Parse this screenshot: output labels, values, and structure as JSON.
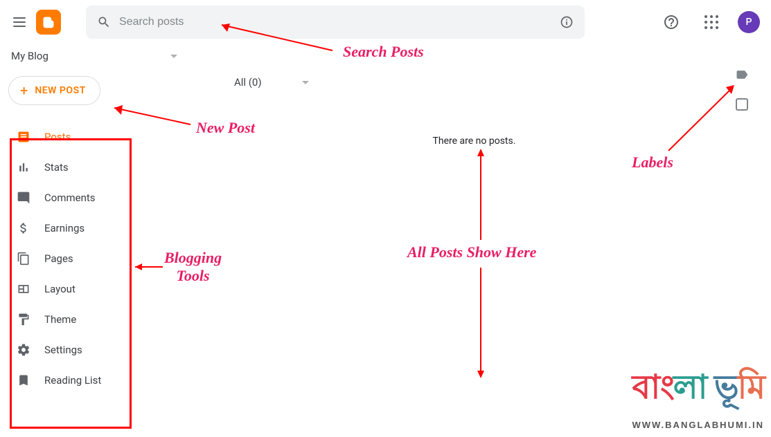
{
  "header": {
    "search_placeholder": "Search posts",
    "avatar_letter": "P"
  },
  "blog": {
    "name": "My Blog"
  },
  "sidebar": {
    "new_post_label": "NEW POST",
    "items": [
      {
        "label": "Posts"
      },
      {
        "label": "Stats"
      },
      {
        "label": "Comments"
      },
      {
        "label": "Earnings"
      },
      {
        "label": "Pages"
      },
      {
        "label": "Layout"
      },
      {
        "label": "Theme"
      },
      {
        "label": "Settings"
      },
      {
        "label": "Reading List"
      }
    ]
  },
  "content": {
    "filter_label": "All (0)",
    "empty_message": "There are no posts."
  },
  "annotations": {
    "search_posts": "Search Posts",
    "new_post": "New Post",
    "blogging_tools": "Blogging\nTools",
    "all_posts": "All Posts Show Here",
    "labels": "Labels"
  },
  "watermark": {
    "url": "WWW.BANGLABHUMI.IN"
  }
}
